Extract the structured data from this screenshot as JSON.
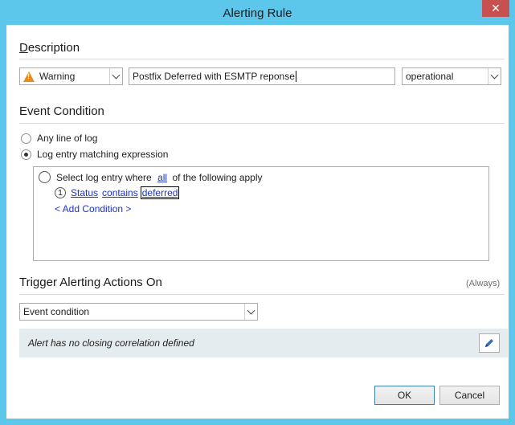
{
  "window": {
    "title": "Alerting Rule",
    "close_glyph": "✕"
  },
  "description": {
    "heading_first": "D",
    "heading_rest": "escription",
    "severity": {
      "value": "Warning",
      "icon": "warning-icon",
      "icon_color": "#e88b1a"
    },
    "name": "Postfix Deferred with ESMTP reponse",
    "category": "operational"
  },
  "event_condition": {
    "heading": "Event Condition",
    "option_any": "Any line of log",
    "option_matching": "Log entry matching expression",
    "rule_prefix": "Select log entry where",
    "rule_quantifier": "all",
    "rule_suffix": "of the following apply",
    "condition": {
      "index": "1",
      "field": "Status",
      "operator": "contains",
      "value": "deferred"
    },
    "add_condition": "< Add Condition >"
  },
  "trigger": {
    "heading": "Trigger Alerting Actions On",
    "note": "(Always)",
    "mode": "Event condition",
    "closing_info": "Alert has no closing correlation defined"
  },
  "buttons": {
    "ok": "OK",
    "cancel": "Cancel"
  },
  "colors": {
    "accent": "#5cc6eb",
    "link": "#1a33cc",
    "close": "#c75050"
  }
}
